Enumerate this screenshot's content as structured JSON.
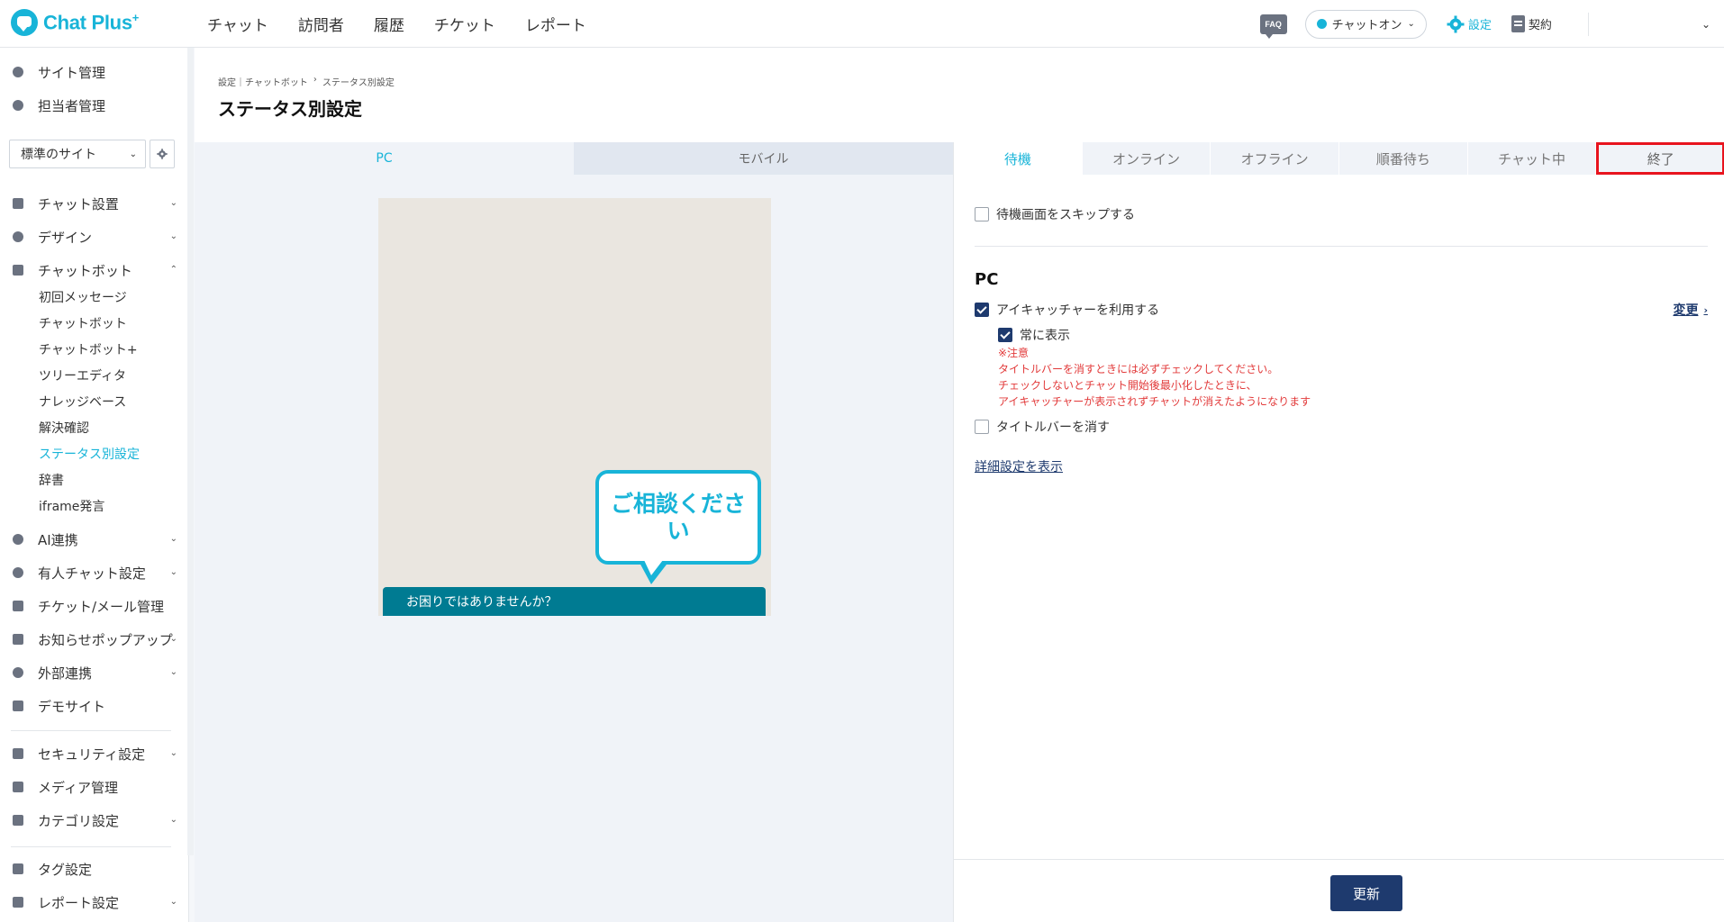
{
  "brand": {
    "name": "Chat Plus",
    "superscript": "+"
  },
  "topnav": [
    "チャット",
    "訪問者",
    "履歴",
    "チケット",
    "レポート"
  ],
  "topright": {
    "faq": "FAQ",
    "status": "チャットオン",
    "settings": "設定",
    "contract": "契約"
  },
  "sidebar": {
    "top": [
      {
        "label": "サイト管理",
        "icon": "gear-icon"
      },
      {
        "label": "担当者管理",
        "icon": "users-icon"
      }
    ],
    "site_select": "標準のサイト",
    "menu": [
      {
        "label": "チャット設置",
        "icon": "tools-icon",
        "arrow": true
      },
      {
        "label": "デザイン",
        "icon": "palette-icon",
        "arrow": true
      },
      {
        "label": "チャットボット",
        "icon": "chat-icon",
        "arrow": true
      }
    ],
    "chatbot_sub": [
      "初回メッセージ",
      "チャットボット",
      "チャットボット+",
      "ツリーエディタ",
      "ナレッジベース",
      "解決確認",
      "ステータス別設定",
      "辞書",
      "iframe発言"
    ],
    "active_sub": "ステータス別設定",
    "menu2": [
      {
        "label": "AI連携",
        "icon": "ai-icon",
        "arrow": true
      },
      {
        "label": "有人チャット設定",
        "icon": "headset-icon",
        "arrow": true
      },
      {
        "label": "チケット/メール管理",
        "icon": "ticket-icon",
        "arrow": false
      },
      {
        "label": "お知らせポップアップ",
        "icon": "popup-icon",
        "arrow": true
      },
      {
        "label": "外部連携",
        "icon": "share-icon",
        "arrow": true
      },
      {
        "label": "デモサイト",
        "icon": "demo-icon",
        "arrow": false
      }
    ],
    "menu3": [
      {
        "label": "セキュリティ設定",
        "icon": "lock-icon",
        "arrow": true
      },
      {
        "label": "メディア管理",
        "icon": "image-icon",
        "arrow": false
      },
      {
        "label": "カテゴリ設定",
        "icon": "folder-icon",
        "arrow": true
      }
    ],
    "menu4": [
      {
        "label": "タグ設定",
        "icon": "tag-icon",
        "arrow": false
      },
      {
        "label": "レポート設定",
        "icon": "report-icon",
        "arrow": true
      }
    ]
  },
  "page": {
    "breadcrumb": [
      "設定｜チャットボット",
      "›",
      "ステータス別設定"
    ],
    "title": "ステータス別設定"
  },
  "device_tabs": [
    "PC",
    "モバイル"
  ],
  "preview": {
    "bubble": "ご相談ください",
    "bar": "お困りではありませんか？"
  },
  "status_tabs": [
    "待機",
    "オンライン",
    "オフライン",
    "順番待ち",
    "チャット中",
    "終了"
  ],
  "form": {
    "skip_waiting": "待機画面をスキップする",
    "section": "PC",
    "use_eyecatcher": "アイキャッチャーを利用する",
    "change": "変更",
    "always_show": "常に表示",
    "notes": [
      "※注意",
      "タイトルバーを消すときには必ずチェックしてください。",
      "チェックしないとチャット開始後最小化したときに、",
      "アイキャッチャーが表示されずチャットが消えたようになります"
    ],
    "hide_titlebar": "タイトルバーを消す",
    "detail": "詳細設定を表示",
    "update": "更新"
  },
  "colors": {
    "accent": "#18b4d8",
    "navy": "#1e3a6e",
    "highlight": "#e8141e",
    "warning": "#e23a3a"
  }
}
